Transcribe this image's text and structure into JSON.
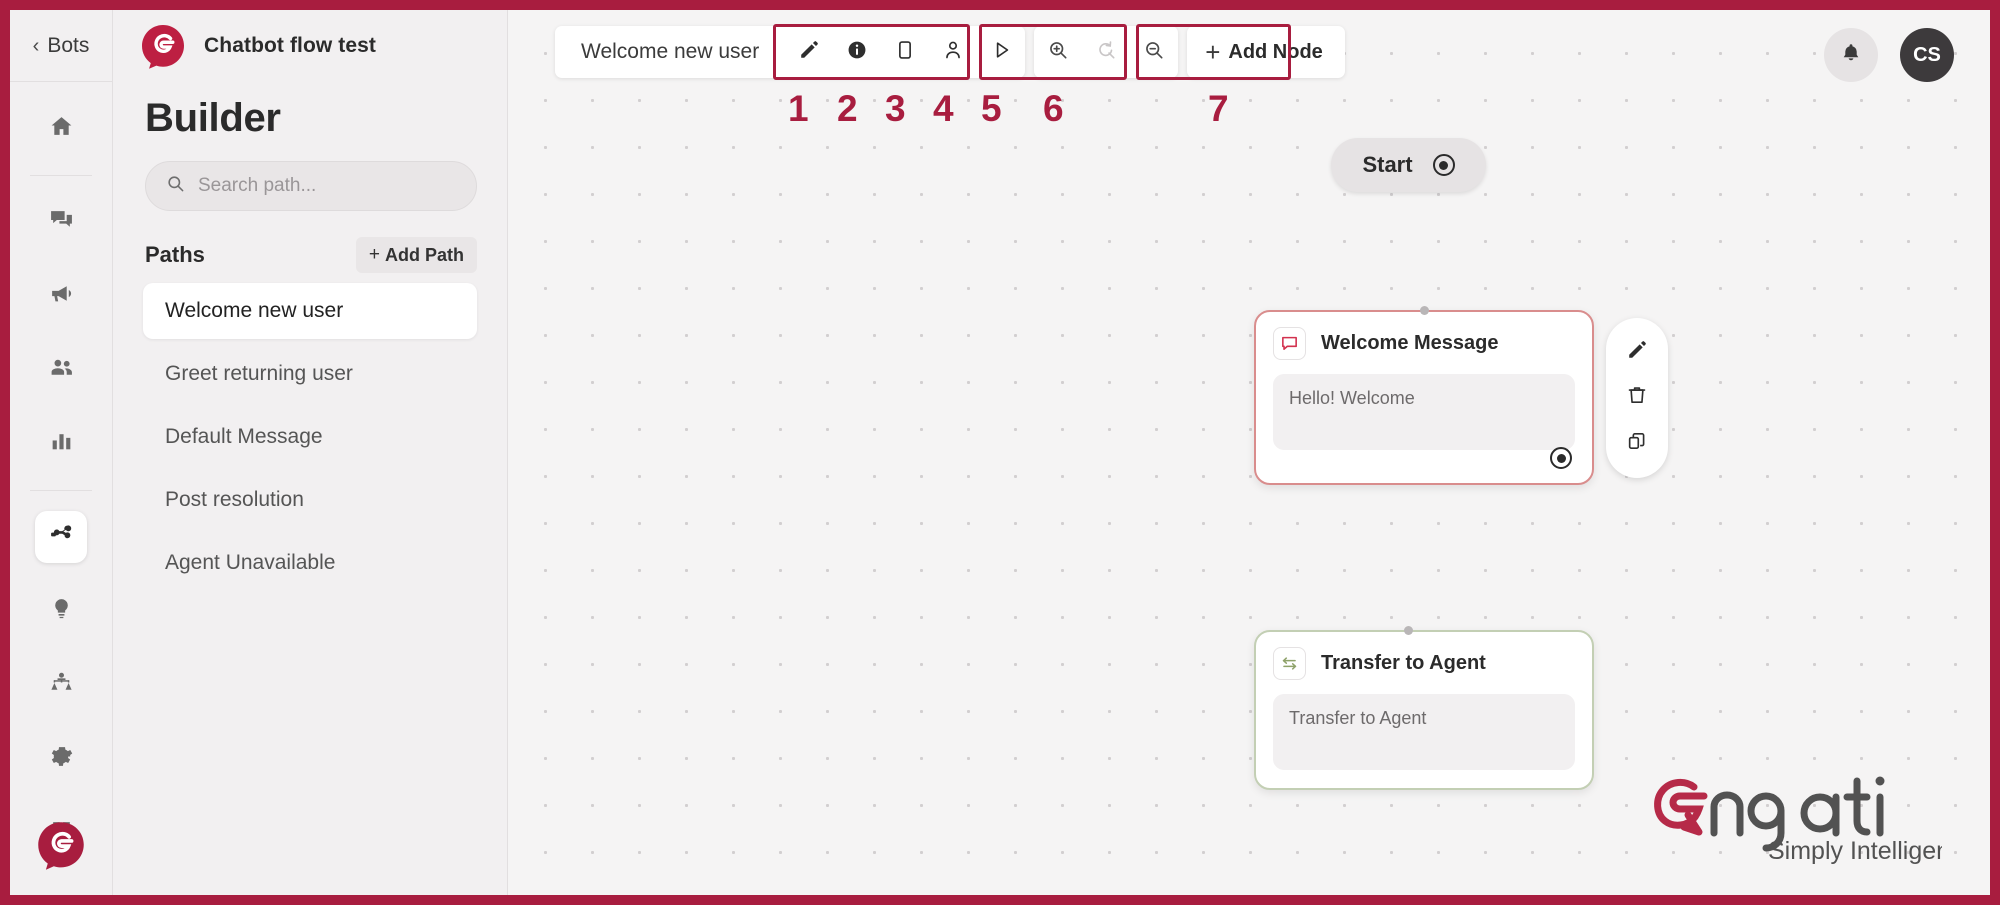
{
  "theme": {
    "brand": "#a81d3f",
    "canvas_bg": "#f5f4f4",
    "panel_bg": "#f2f0f1",
    "annotation": "#a81d3f"
  },
  "rail": {
    "back_label": "Bots",
    "items": [
      {
        "name": "home",
        "label": "Home",
        "active": false
      },
      {
        "name": "conversations",
        "label": "Conversations",
        "active": false
      },
      {
        "name": "broadcast",
        "label": "Broadcast",
        "active": false
      },
      {
        "name": "contacts",
        "label": "Contacts",
        "active": false
      },
      {
        "name": "analytics",
        "label": "Analytics",
        "active": false
      },
      {
        "name": "flow-builder",
        "label": "Flow Builder",
        "active": true
      },
      {
        "name": "insights",
        "label": "Insights",
        "active": false
      },
      {
        "name": "training",
        "label": "Training",
        "active": false
      },
      {
        "name": "settings",
        "label": "Settings",
        "active": false
      },
      {
        "name": "integrations",
        "label": "Integrations",
        "active": false
      }
    ]
  },
  "panel": {
    "bot_name": "Chatbot flow test",
    "heading": "Builder",
    "search_placeholder": "Search path...",
    "search_value": "",
    "paths_label": "Paths",
    "add_path_label": "Add Path",
    "add_path_plus": "+",
    "paths": [
      {
        "label": "Welcome new user",
        "selected": true
      },
      {
        "label": "Greet returning user",
        "selected": false
      },
      {
        "label": "Default Message",
        "selected": false
      },
      {
        "label": "Post resolution",
        "selected": false
      },
      {
        "label": "Agent Unavailable",
        "selected": false
      }
    ]
  },
  "toolbar": {
    "path_title": "Welcome new user",
    "actions": [
      {
        "icon": "pencil-icon",
        "label": "Rename path"
      },
      {
        "icon": "info-icon",
        "label": "Path info"
      },
      {
        "icon": "copy-icon",
        "label": "Duplicate path"
      },
      {
        "icon": "user-icon",
        "label": "Assign user"
      },
      {
        "icon": "play-icon",
        "label": "Test path"
      }
    ],
    "zoom_actions": [
      {
        "icon": "zoom-in-icon",
        "label": "Zoom in",
        "disabled": false
      },
      {
        "icon": "reset-icon",
        "label": "Reset view",
        "disabled": true
      },
      {
        "icon": "zoom-out-icon",
        "label": "Zoom out",
        "disabled": false
      }
    ],
    "add_node_label": "Add Node",
    "add_node_plus": "+"
  },
  "annotations": [
    {
      "number": "1",
      "target": "pencil-icon"
    },
    {
      "number": "2",
      "target": "info-icon"
    },
    {
      "number": "3",
      "target": "copy-icon"
    },
    {
      "number": "4",
      "target": "user-icon"
    },
    {
      "number": "5",
      "target": "play-icon"
    },
    {
      "number": "6",
      "target": "zoom-controls"
    },
    {
      "number": "7",
      "target": "add-node-button"
    }
  ],
  "canvas": {
    "start_node": {
      "label": "Start"
    },
    "nodes": [
      {
        "id": "welcome-message",
        "title": "Welcome Message",
        "body": "Hello! Welcome",
        "icon": "chat-bubble-icon",
        "accent": "#d98d8d"
      },
      {
        "id": "transfer-to-agent",
        "title": "Transfer to Agent",
        "body": "Transfer to Agent",
        "icon": "transfer-arrows-icon",
        "accent": "#c3cfb4"
      }
    ],
    "node_tools": [
      {
        "icon": "pencil-icon",
        "label": "Edit node"
      },
      {
        "icon": "trash-icon",
        "label": "Delete node"
      },
      {
        "icon": "copy-icon",
        "label": "Duplicate node"
      }
    ]
  },
  "topbar": {
    "notification_icon": "bell-icon",
    "avatar_initials": "CS"
  },
  "watermark": {
    "wordmark": "engati",
    "tagline": "Simply Intelligent"
  }
}
